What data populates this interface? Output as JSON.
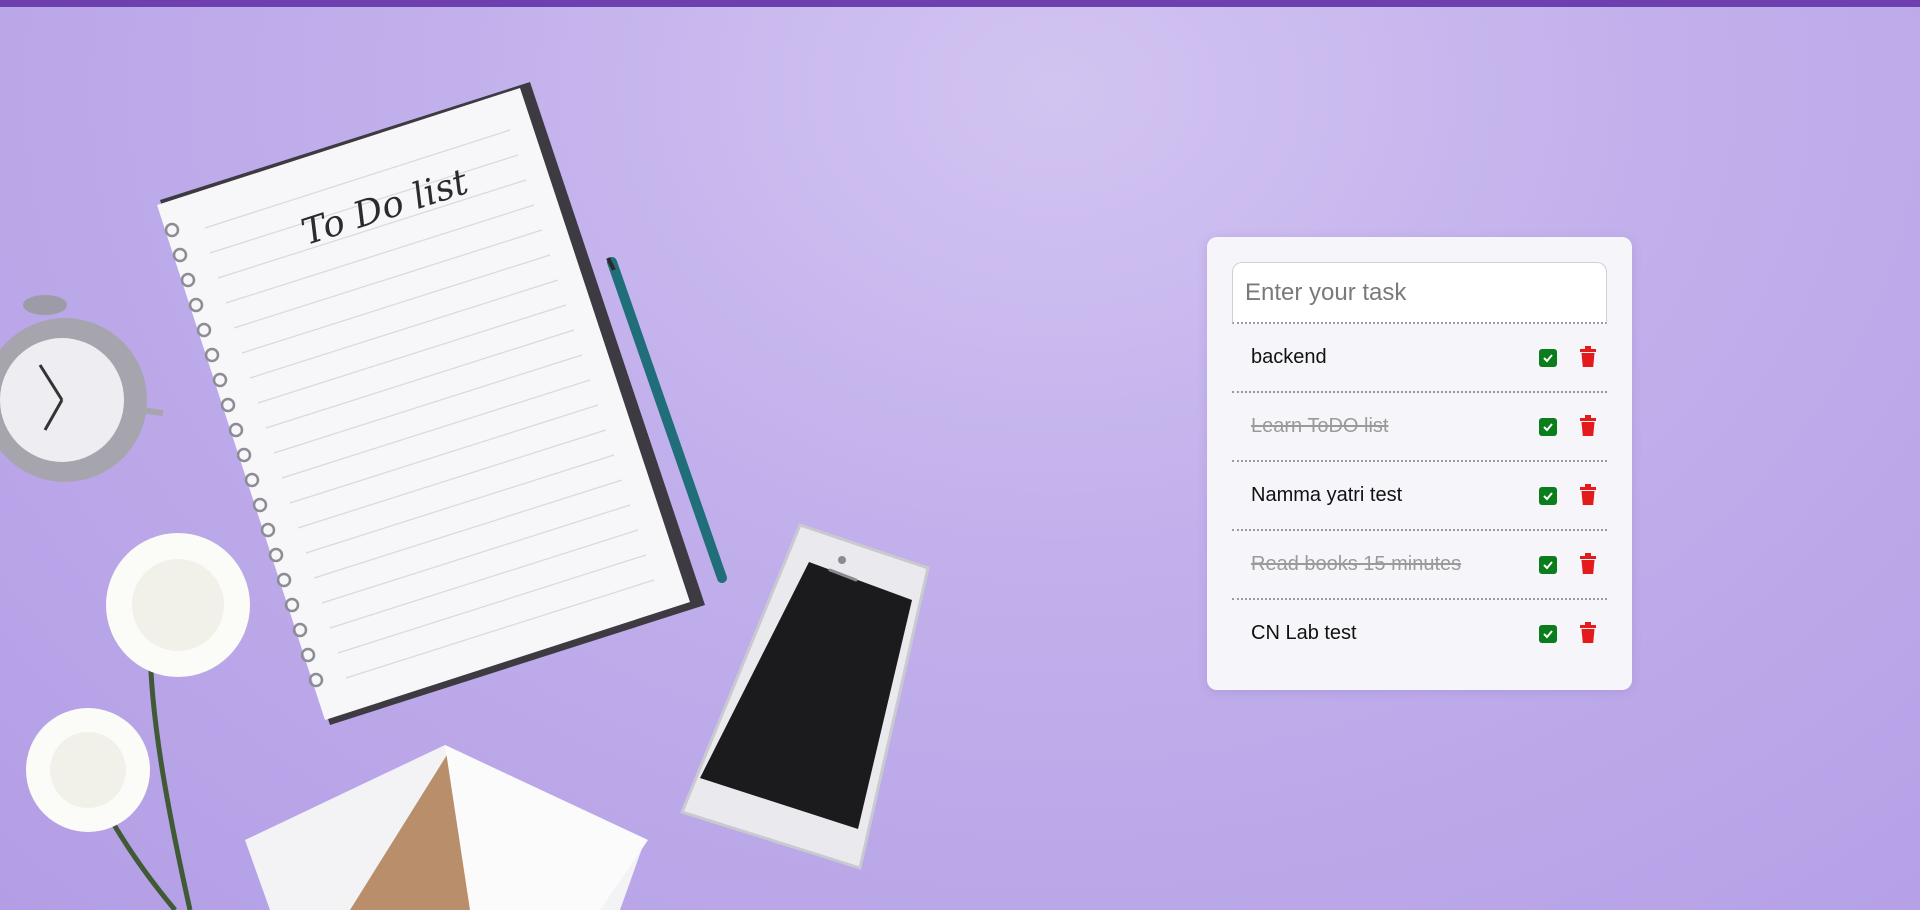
{
  "task_form": {
    "input_placeholder": "Enter your task",
    "input_value": ""
  },
  "tasks": [
    {
      "text": "backend",
      "done": false
    },
    {
      "text": "Learn ToDO list",
      "done": true
    },
    {
      "text": "Namma yatri test",
      "done": false
    },
    {
      "text": "Read books 15 minutes",
      "done": true
    },
    {
      "text": "CN Lab test",
      "done": false
    }
  ],
  "background": {
    "notebook_title": "To Do list"
  },
  "colors": {
    "accent_bar": "#6e3fae",
    "complete_button": "#0b7d1c",
    "delete_button": "#e31b1b",
    "done_text": "#9a9a9a"
  }
}
